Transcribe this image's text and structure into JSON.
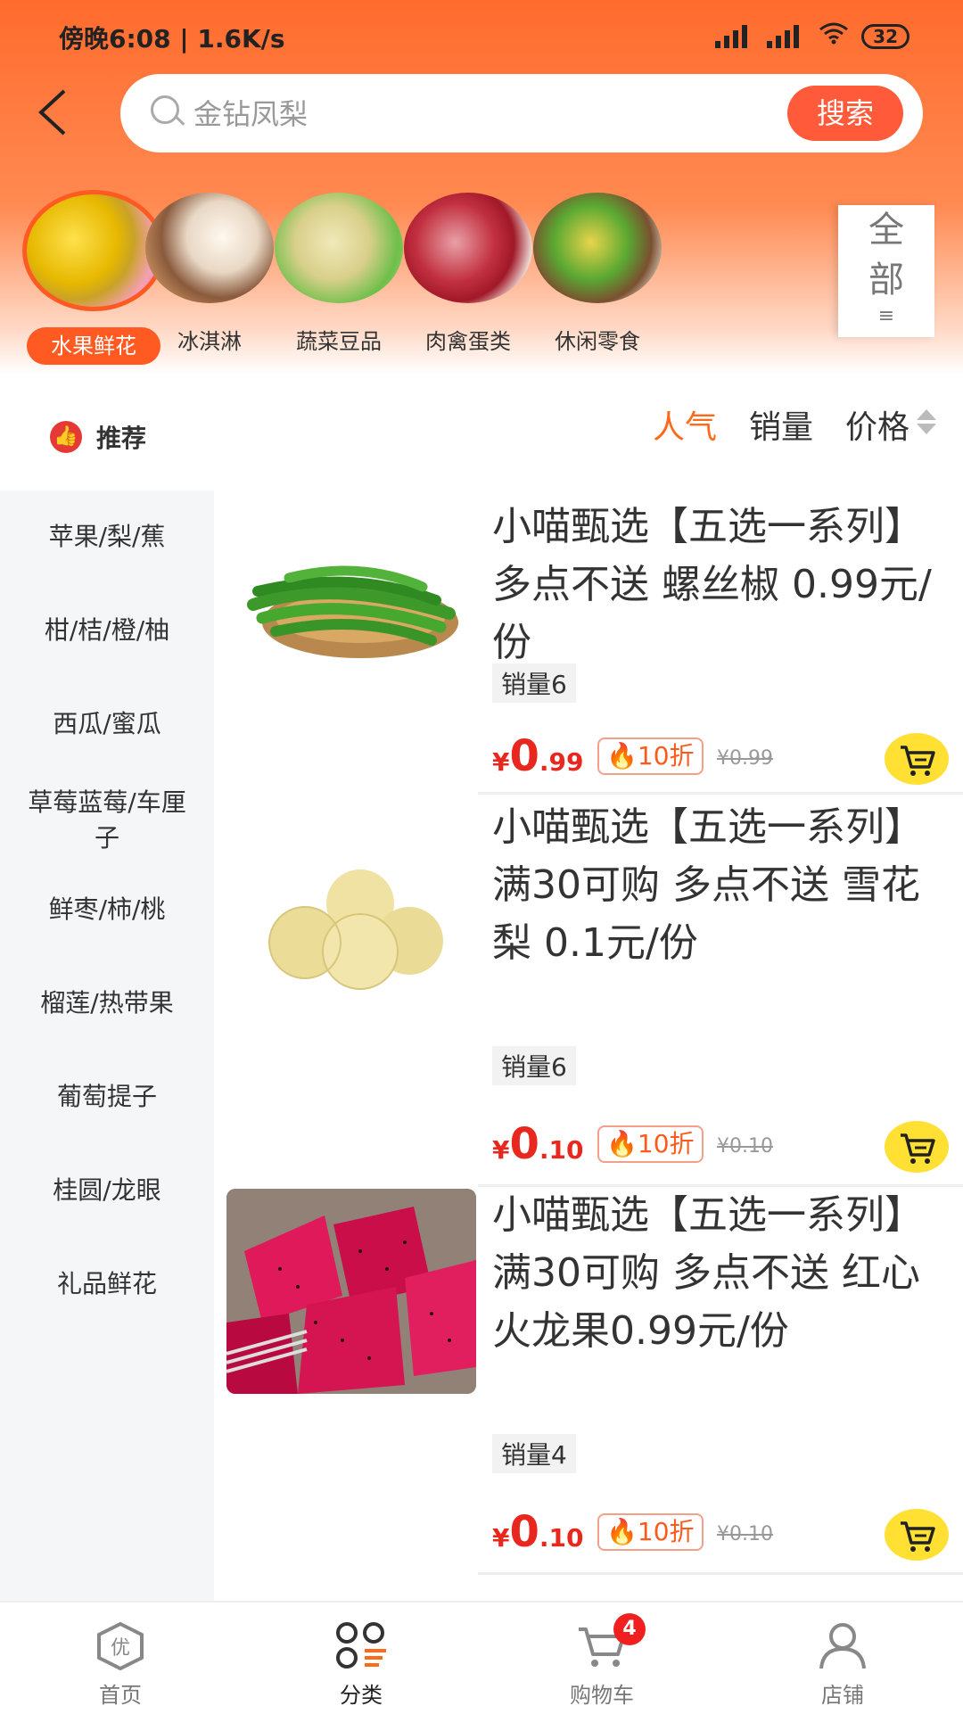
{
  "status_bar": {
    "time": "傍晚6:08 | 1.6K/s",
    "battery": "32"
  },
  "search": {
    "placeholder": "金钻凤梨",
    "button": "搜索"
  },
  "categories": [
    {
      "label": "水果鲜花",
      "active": true
    },
    {
      "label": "冰淇淋"
    },
    {
      "label": "蔬菜豆品"
    },
    {
      "label": "肉禽蛋类"
    },
    {
      "label": "休闲零食"
    }
  ],
  "all_button": {
    "line1": "全",
    "line2": "部"
  },
  "recommend_label": "推荐",
  "sorts": {
    "popular": "人气",
    "sales": "销量",
    "price": "价格"
  },
  "sidebar": [
    "苹果/梨/蕉",
    "柑/桔/橙/柚",
    "西瓜/蜜瓜",
    "草莓蓝莓/车厘子",
    "鲜枣/柿/桃",
    "榴莲/热带果",
    "葡萄提子",
    "桂圆/龙眼",
    "礼品鲜花"
  ],
  "products": [
    {
      "title": "小喵甄选【五选一系列】多点不送 螺丝椒 0.99元/份",
      "sales": "销量6",
      "price_symbol": "¥",
      "price_int": "0",
      "price_dec": ".99",
      "discount": "10折",
      "original": "¥0.99",
      "image": "green-peppers-image"
    },
    {
      "title": "小喵甄选【五选一系列】满30可购 多点不送 雪花梨 0.1元/份",
      "sales": "销量6",
      "price_symbol": "¥",
      "price_int": "0",
      "price_dec": ".10",
      "discount": "10折",
      "original": "¥0.10",
      "image": "snow-pears-image"
    },
    {
      "title": "小喵甄选【五选一系列】满30可购 多点不送 红心火龙果0.99元/份",
      "sales": "销量4",
      "price_symbol": "¥",
      "price_int": "0",
      "price_dec": ".10",
      "discount": "10折",
      "original": "¥0.10",
      "image": "dragon-fruit-image"
    }
  ],
  "tabbar": [
    {
      "label": "首页",
      "icon": "home-icon"
    },
    {
      "label": "分类",
      "icon": "category-icon",
      "active": true
    },
    {
      "label": "购物车",
      "icon": "cart-icon",
      "badge": "4"
    },
    {
      "label": "店铺",
      "icon": "shop-user-icon"
    }
  ],
  "badge_icon_text": "优"
}
